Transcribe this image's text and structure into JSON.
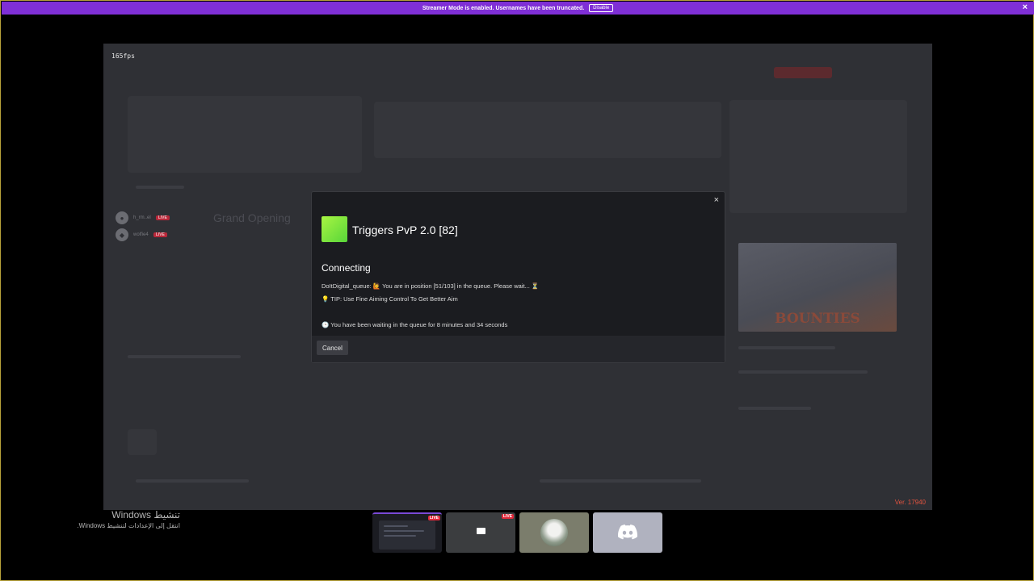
{
  "streamer_bar": {
    "message": "Streamer Mode is enabled. Usernames have been truncated.",
    "disable_label": "Disable",
    "close_glyph": "×"
  },
  "game": {
    "fps": "165fps",
    "version": "Ver. 17940",
    "side_users": [
      {
        "name": "h_rm..el",
        "badge": "LIVE"
      },
      {
        "name": "wolfie4",
        "badge": "LIVE"
      }
    ],
    "background_title": "Grand Opening",
    "bounty_title": "BOUNTIES"
  },
  "modal": {
    "close_glyph": "×",
    "game_title": "Triggers PvP 2.0 [82]",
    "status": "Connecting",
    "queue_message": "DoItDigital_queue: 🙋 You are in position [51/103] in the queue. Please wait... ⏳",
    "tip_message": "💡 TIP: Use Fine Aiming Control To Get Better Aim",
    "wait_message": "🕒 You have been waiting in the queue for 8 minutes and 34 seconds",
    "cancel_label": "Cancel"
  },
  "activate_windows": {
    "line1": "تنشيط Windows",
    "line2": "انتقل إلى الإعدادات لتنشيط Windows."
  },
  "taskbar_previews": [
    {
      "badge": "LIVE"
    },
    {
      "badge": "LIVE"
    },
    {
      "badge": ""
    },
    {
      "badge": ""
    }
  ],
  "colors": {
    "accent_purple": "#7f2fd6",
    "live_red": "#e0283a",
    "version_red": "#e0533f"
  }
}
